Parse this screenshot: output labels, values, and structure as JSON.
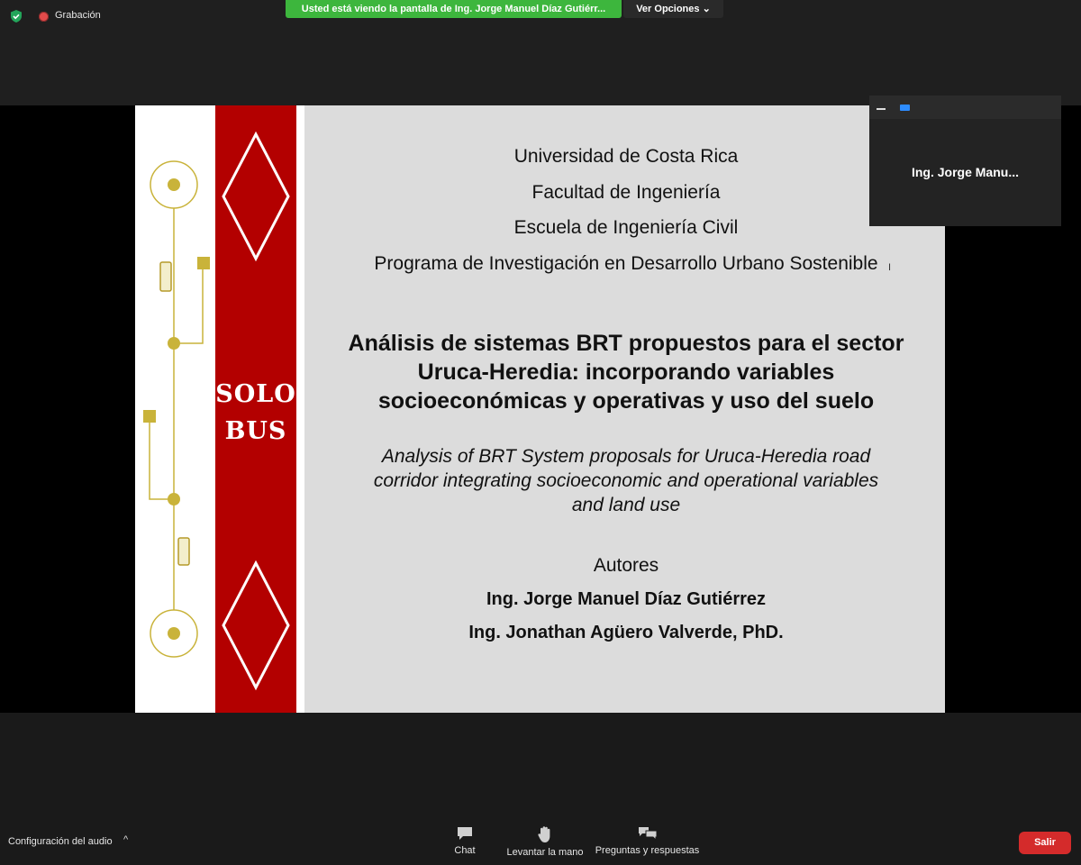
{
  "topbar": {
    "recording_label": "Grabación",
    "share_banner": "Usted está viendo la pantalla de Ing. Jorge Manuel Díaz Gutiérr...",
    "view_options": "Ver Opciones ⌄"
  },
  "slide": {
    "solo": "SOLO",
    "bus": "BUS",
    "institution": [
      "Universidad de Costa Rica",
      "Facultad de Ingeniería",
      "Escuela de Ingeniería Civil",
      "Programa de Investigación en Desarrollo Urbano Sostenible"
    ],
    "title_es": [
      "Análisis de sistemas BRT propuestos para el sector",
      "Uruca-Heredia: incorporando variables",
      "socioeconómicas y operativas y uso del suelo"
    ],
    "title_en": [
      "Analysis of BRT System proposals for Uruca-Heredia road",
      "corridor integrating socioeconomic and operational variables",
      "and land use"
    ],
    "authors_heading": "Autores",
    "authors": [
      "Ing. Jorge Manuel Díaz Gutiérrez",
      "Ing. Jonathan Agüero Valverde, PhD."
    ]
  },
  "thumbnail": {
    "name": "Ing. Jorge Manu..."
  },
  "toolbar": {
    "audio_settings": "Configuración del audio",
    "chat": "Chat",
    "raise_hand": "Levantar la mano",
    "qa": "Preguntas y respuestas",
    "leave": "Salir"
  },
  "colors": {
    "banner_green": "#3db63d",
    "leave_red": "#d42b2b",
    "slide_red": "#b30000",
    "gold": "#c9b33a"
  }
}
